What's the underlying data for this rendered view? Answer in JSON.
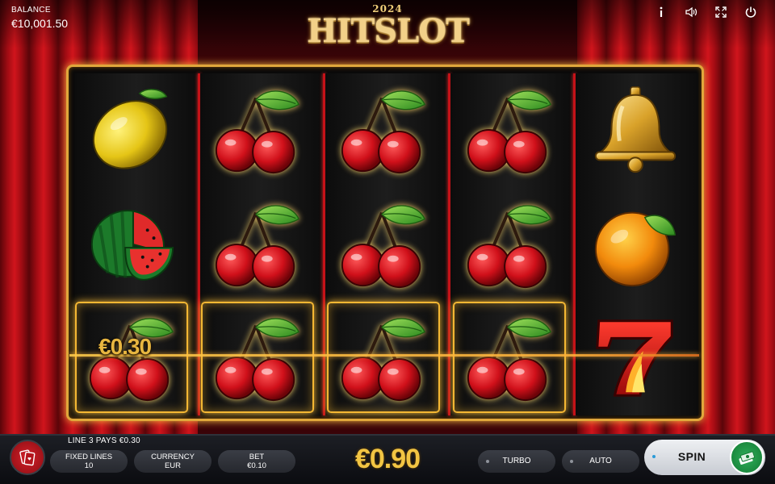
{
  "header": {
    "balance_label": "BALANCE",
    "balance_value": "€10,001.50",
    "icons": [
      "info-icon",
      "sound-icon",
      "fullscreen-icon",
      "power-icon"
    ]
  },
  "logo": {
    "year": "2024",
    "title": "HITSLOT"
  },
  "reels": [
    [
      "lemon",
      "watermelon",
      "cherry"
    ],
    [
      "cherry",
      "cherry",
      "cherry"
    ],
    [
      "cherry",
      "cherry",
      "cherry"
    ],
    [
      "cherry",
      "cherry",
      "cherry"
    ],
    [
      "bell",
      "orange",
      "seven"
    ]
  ],
  "win": {
    "amount": "€0.30",
    "line_text": "LINE 3 PAYS €0.30"
  },
  "controls": {
    "fixed_lines_label": "FIXED LINES",
    "fixed_lines_value": "10",
    "currency_label": "CURRENCY",
    "currency_value": "EUR",
    "bet_label": "BET",
    "bet_value": "€0.10",
    "total_bet": "€0.90",
    "turbo_label": "TURBO",
    "auto_label": "AUTO",
    "spin_label": "SPIN"
  },
  "colors": {
    "accent_gold": "#f2c543",
    "frame_gold": "#e0a73c",
    "reel_divider": "#c51218",
    "spin_green": "#1f9445"
  }
}
